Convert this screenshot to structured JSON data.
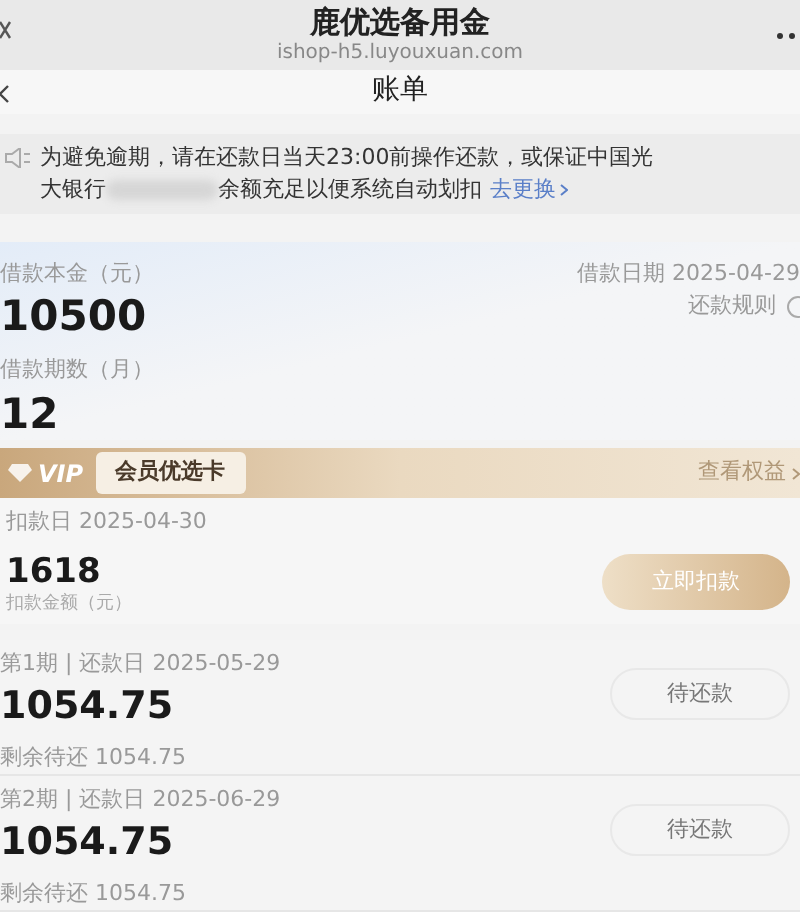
{
  "browser": {
    "title": "鹿优选备用金",
    "url": "ishop-h5.luyouxuan.com"
  },
  "nav": {
    "title": "账单"
  },
  "notice": {
    "line1": "为避免逾期，请在还款日当天23:00前操作还款，或保证中国光",
    "line2_start": "大银行",
    "line2_end": "余额充足以便系统自动划扣",
    "link": "去更换"
  },
  "loan": {
    "principal_label": "借款本金（元）",
    "principal": "10500",
    "term_label": "借款期数（月）",
    "term": "12",
    "date": "借款日期 2025-04-29",
    "rules": "还款规则"
  },
  "vip": {
    "badge": "VIP",
    "card": "会员优选卡",
    "link": "查看权益",
    "deduct_date": "扣款日 2025-04-30",
    "amount": "1618",
    "amount_label": "扣款金额（元）",
    "button": "立即扣款"
  },
  "installments": [
    {
      "period": "第1期 | 还款日 2025-05-29",
      "amount": "1054.75",
      "remaining": "剩余待还 1054.75",
      "status": "待还款"
    },
    {
      "period": "第2期 | 还款日 2025-06-29",
      "amount": "1054.75",
      "remaining": "剩余待还 1054.75",
      "status": "待还款"
    }
  ]
}
